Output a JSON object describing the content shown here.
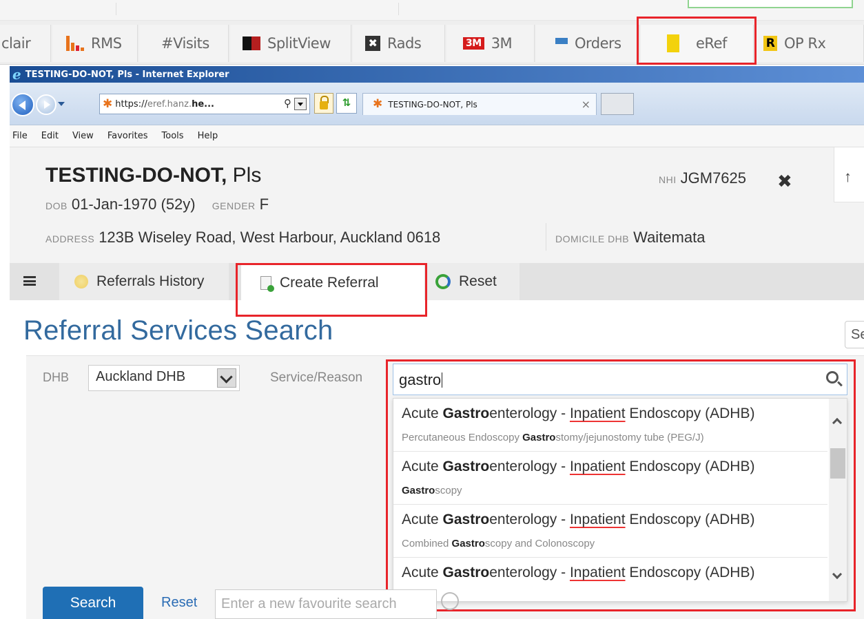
{
  "launcher": {
    "tabs": [
      {
        "label": "clair",
        "icon": "partial-app-icon"
      },
      {
        "label": "RMS",
        "icon": "bar-chart-icon"
      },
      {
        "label": "#Visits",
        "icon": ""
      },
      {
        "label": "SplitView",
        "icon": "splitview-icon"
      },
      {
        "label": "Rads",
        "icon": "rads-icon"
      },
      {
        "label": "3M",
        "icon": "3m-logo-icon",
        "icon_text": "3M"
      },
      {
        "label": "Orders",
        "icon": "list-icon"
      },
      {
        "label": "eRef",
        "icon": "yellow-tag-icon"
      },
      {
        "label": "OP Rx",
        "icon": "r-badge-icon",
        "icon_text": "R"
      }
    ],
    "highlight_color": "#e8242a"
  },
  "browser": {
    "title": "TESTING-DO-NOT, Pls - Internet Explorer",
    "url_prefix": "https://",
    "url_mid": "eref.hanz.",
    "url_bold": "he...",
    "tab_title": "TESTING-DO-NOT, Pls",
    "menu": [
      "File",
      "Edit",
      "View",
      "Favorites",
      "Tools",
      "Help"
    ]
  },
  "patient": {
    "surname": "TESTING-DO-NOT,",
    "given": "Pls",
    "dob_label": "DOB",
    "dob": "01-Jan-1970 (52y)",
    "gender_label": "GENDER",
    "gender": "F",
    "address_label": "ADDRESS",
    "address": "123B Wiseley Road, West Harbour, Auckland 0618",
    "domicile_label": "DOMICILE DHB",
    "domicile": "Waitemata",
    "nhi_label": "NHI",
    "nhi": "JGM7625"
  },
  "tabs": {
    "history": "Referrals History",
    "create": "Create Referral",
    "reset": "Reset"
  },
  "page": {
    "title": "Referral Services Search",
    "right_button_partial": "Se"
  },
  "form": {
    "dhb_label": "DHB",
    "dhb_value": "Auckland DHB",
    "service_label": "Service/Reason",
    "service_query": "gastro",
    "search_button": "Search",
    "reset_link": "Reset",
    "favourite_placeholder": "Enter a new favourite search"
  },
  "results": [
    {
      "pre": "Acute ",
      "bold": "Gastro",
      "mid": "enterology - ",
      "underlined": "Inpatient",
      "post": " Endoscopy (ADHB)",
      "sub_pre": "Percutaneous Endoscopy ",
      "sub_bold": "Gastro",
      "sub_post": "stomy/jejunostomy tube (PEG/J)"
    },
    {
      "pre": "Acute ",
      "bold": "Gastro",
      "mid": "enterology - ",
      "underlined": "Inpatient",
      "post": " Endoscopy (ADHB)",
      "sub_pre": "",
      "sub_bold": "Gastro",
      "sub_post": "scopy"
    },
    {
      "pre": "Acute ",
      "bold": "Gastro",
      "mid": "enterology - ",
      "underlined": "Inpatient",
      "post": " Endoscopy (ADHB)",
      "sub_pre": "Combined ",
      "sub_bold": "Gastro",
      "sub_post": "scopy and Colonoscopy"
    },
    {
      "pre": "Acute ",
      "bold": "Gastro",
      "mid": "enterology - ",
      "underlined": "Inpatient",
      "post": " Endoscopy (ADHB)",
      "sub_pre": "",
      "sub_bold": "",
      "sub_post": ""
    }
  ]
}
